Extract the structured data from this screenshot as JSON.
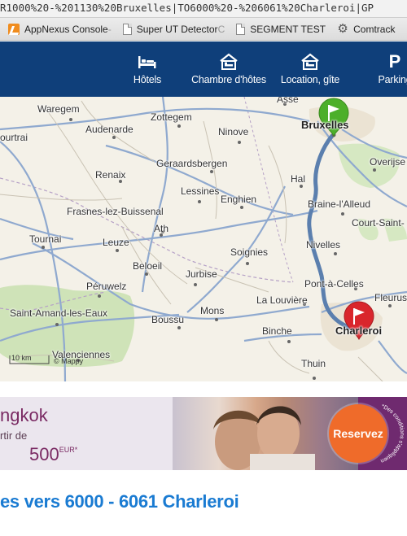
{
  "browser": {
    "url_text": "R1000%20-%201130%20Bruxelles|TO6000%20-%206061%20Charleroi|GP",
    "bookmarks": [
      {
        "label": "AppNexus Console",
        "fade": " -",
        "icon": "appnexus-icon"
      },
      {
        "label": "Super UT Detector",
        "fade": " C",
        "icon": "page-icon"
      },
      {
        "label": "SEGMENT TEST",
        "fade": "",
        "icon": "page-icon"
      },
      {
        "label": "Comtrack",
        "fade": "",
        "icon": "gear-icon"
      }
    ]
  },
  "nav": {
    "background": "#0f3f7a",
    "items": [
      {
        "label": "Hôtels",
        "icon": "bed-icon"
      },
      {
        "label": "Chambre d'hôtes",
        "icon": "guesthouse-icon"
      },
      {
        "label": "Location, gîte",
        "icon": "house-icon"
      },
      {
        "label": "Parking",
        "icon": "parking-icon",
        "glyph": "P"
      }
    ]
  },
  "map": {
    "cities": {
      "waregem": "Waregem",
      "zottegem": "Zottegem",
      "asse": "Asse",
      "bruxelles": "Bruxelles",
      "kortrijk": "ourtrai",
      "audenarde": "Audenarde",
      "ninove": "Ninove",
      "overijse": "Overijse",
      "geraardsbergen": "Geraardsbergen",
      "renaix": "Renaix",
      "hal": "Hal",
      "lessines": "Lessines",
      "enghien": "Enghien",
      "braine": "Braine-l'Alleud",
      "frasnes": "Frasnes-lez-Buissenal",
      "court": "Court-Saint-",
      "ath": "Ath",
      "tournai": "Tournai",
      "leuze": "Leuze",
      "nivelles": "Nivelles",
      "soignies": "Soignies",
      "beloeil": "Beloeil",
      "jurbise": "Jurbise",
      "pontacelles": "Pont-à-Celles",
      "peruwelz": "Péruwelz",
      "fleurus": "Fleurus",
      "lalouviere": "La Louvière",
      "saintamand": "Saint-Amand-les-Eaux",
      "mons": "Mons",
      "boussu": "Boussu",
      "binche": "Binche",
      "charleroi": "Charleroi",
      "valenciennes": "Valenciennes",
      "thuin": "Thuin"
    },
    "scale_label": "10 km",
    "copyright": "© Mappy",
    "start_marker_color": "#4caf2a",
    "end_marker_color": "#d9262c",
    "route_color": "#5b7fae"
  },
  "ad": {
    "city": "ngkok",
    "from": "rtir de",
    "price": "500",
    "currency": "EUR*",
    "cta": "Reservez",
    "legal": "*Des conditions s'appliquent",
    "accent": "#ef6b2a"
  },
  "headline": "es vers 6000 - 6061 Charleroi"
}
